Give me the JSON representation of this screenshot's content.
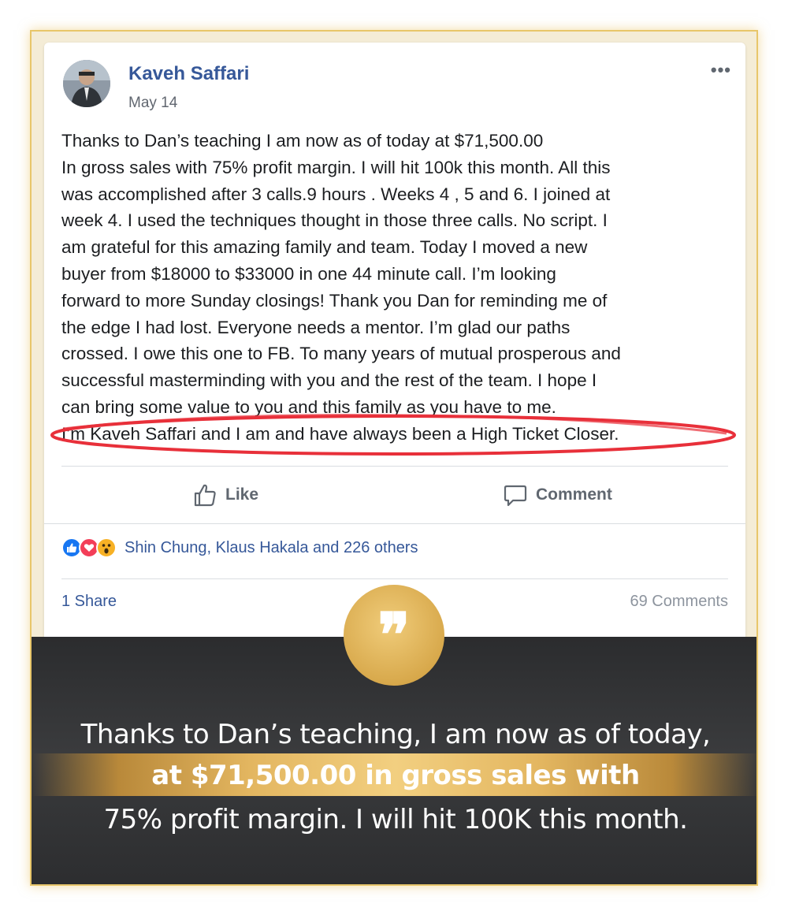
{
  "post": {
    "author": "Kaveh Saffari",
    "date": "May 14",
    "menu_icon": "more-options-icon",
    "body_lines": [
      "Thanks to Dan’s teaching I am now as of today at $71,500.00",
      "In gross sales with 75% profit margin. I will hit 100k this month. All this",
      "was accomplished after 3 calls.9 hours . Weeks 4 , 5 and 6. I joined at",
      "week 4. I used the techniques thought in those three calls. No script. I",
      "am grateful for this amazing family and team. Today I moved a new",
      "buyer from $18000 to $33000 in one 44 minute call. I’m looking",
      "forward to more Sunday closings! Thank you Dan for reminding me of",
      "the edge I had lost. Everyone needs a mentor. I’m glad our paths",
      "crossed. I owe this one to FB. To many years of mutual prosperous and",
      "successful masterminding with you and the rest of the team. I hope I",
      "can bring some value to you and this family as you have to me.",
      "I’m Kaveh Saffari and I am and have always been a High Ticket Closer."
    ],
    "highlight_color": "#e8303a"
  },
  "actions": {
    "like_label": "Like",
    "comment_label": "Comment"
  },
  "reactions": {
    "icons": [
      "like-reaction-icon",
      "love-reaction-icon",
      "wow-reaction-icon"
    ],
    "names": "Shin Chung, Klaus Hakala and 226 others"
  },
  "footer": {
    "shares": "1 Share",
    "comments": "69 Comments"
  },
  "quote": {
    "mark": "❞",
    "line1": "Thanks to Dan’s teaching, I am now as of today,",
    "line2": "at $71,500.00 in gross sales with",
    "line3": "75% profit margin. I will hit 100K this month."
  },
  "colors": {
    "link_blue": "#365899",
    "gold": "#e3b660",
    "dark_panel": "#333436"
  }
}
